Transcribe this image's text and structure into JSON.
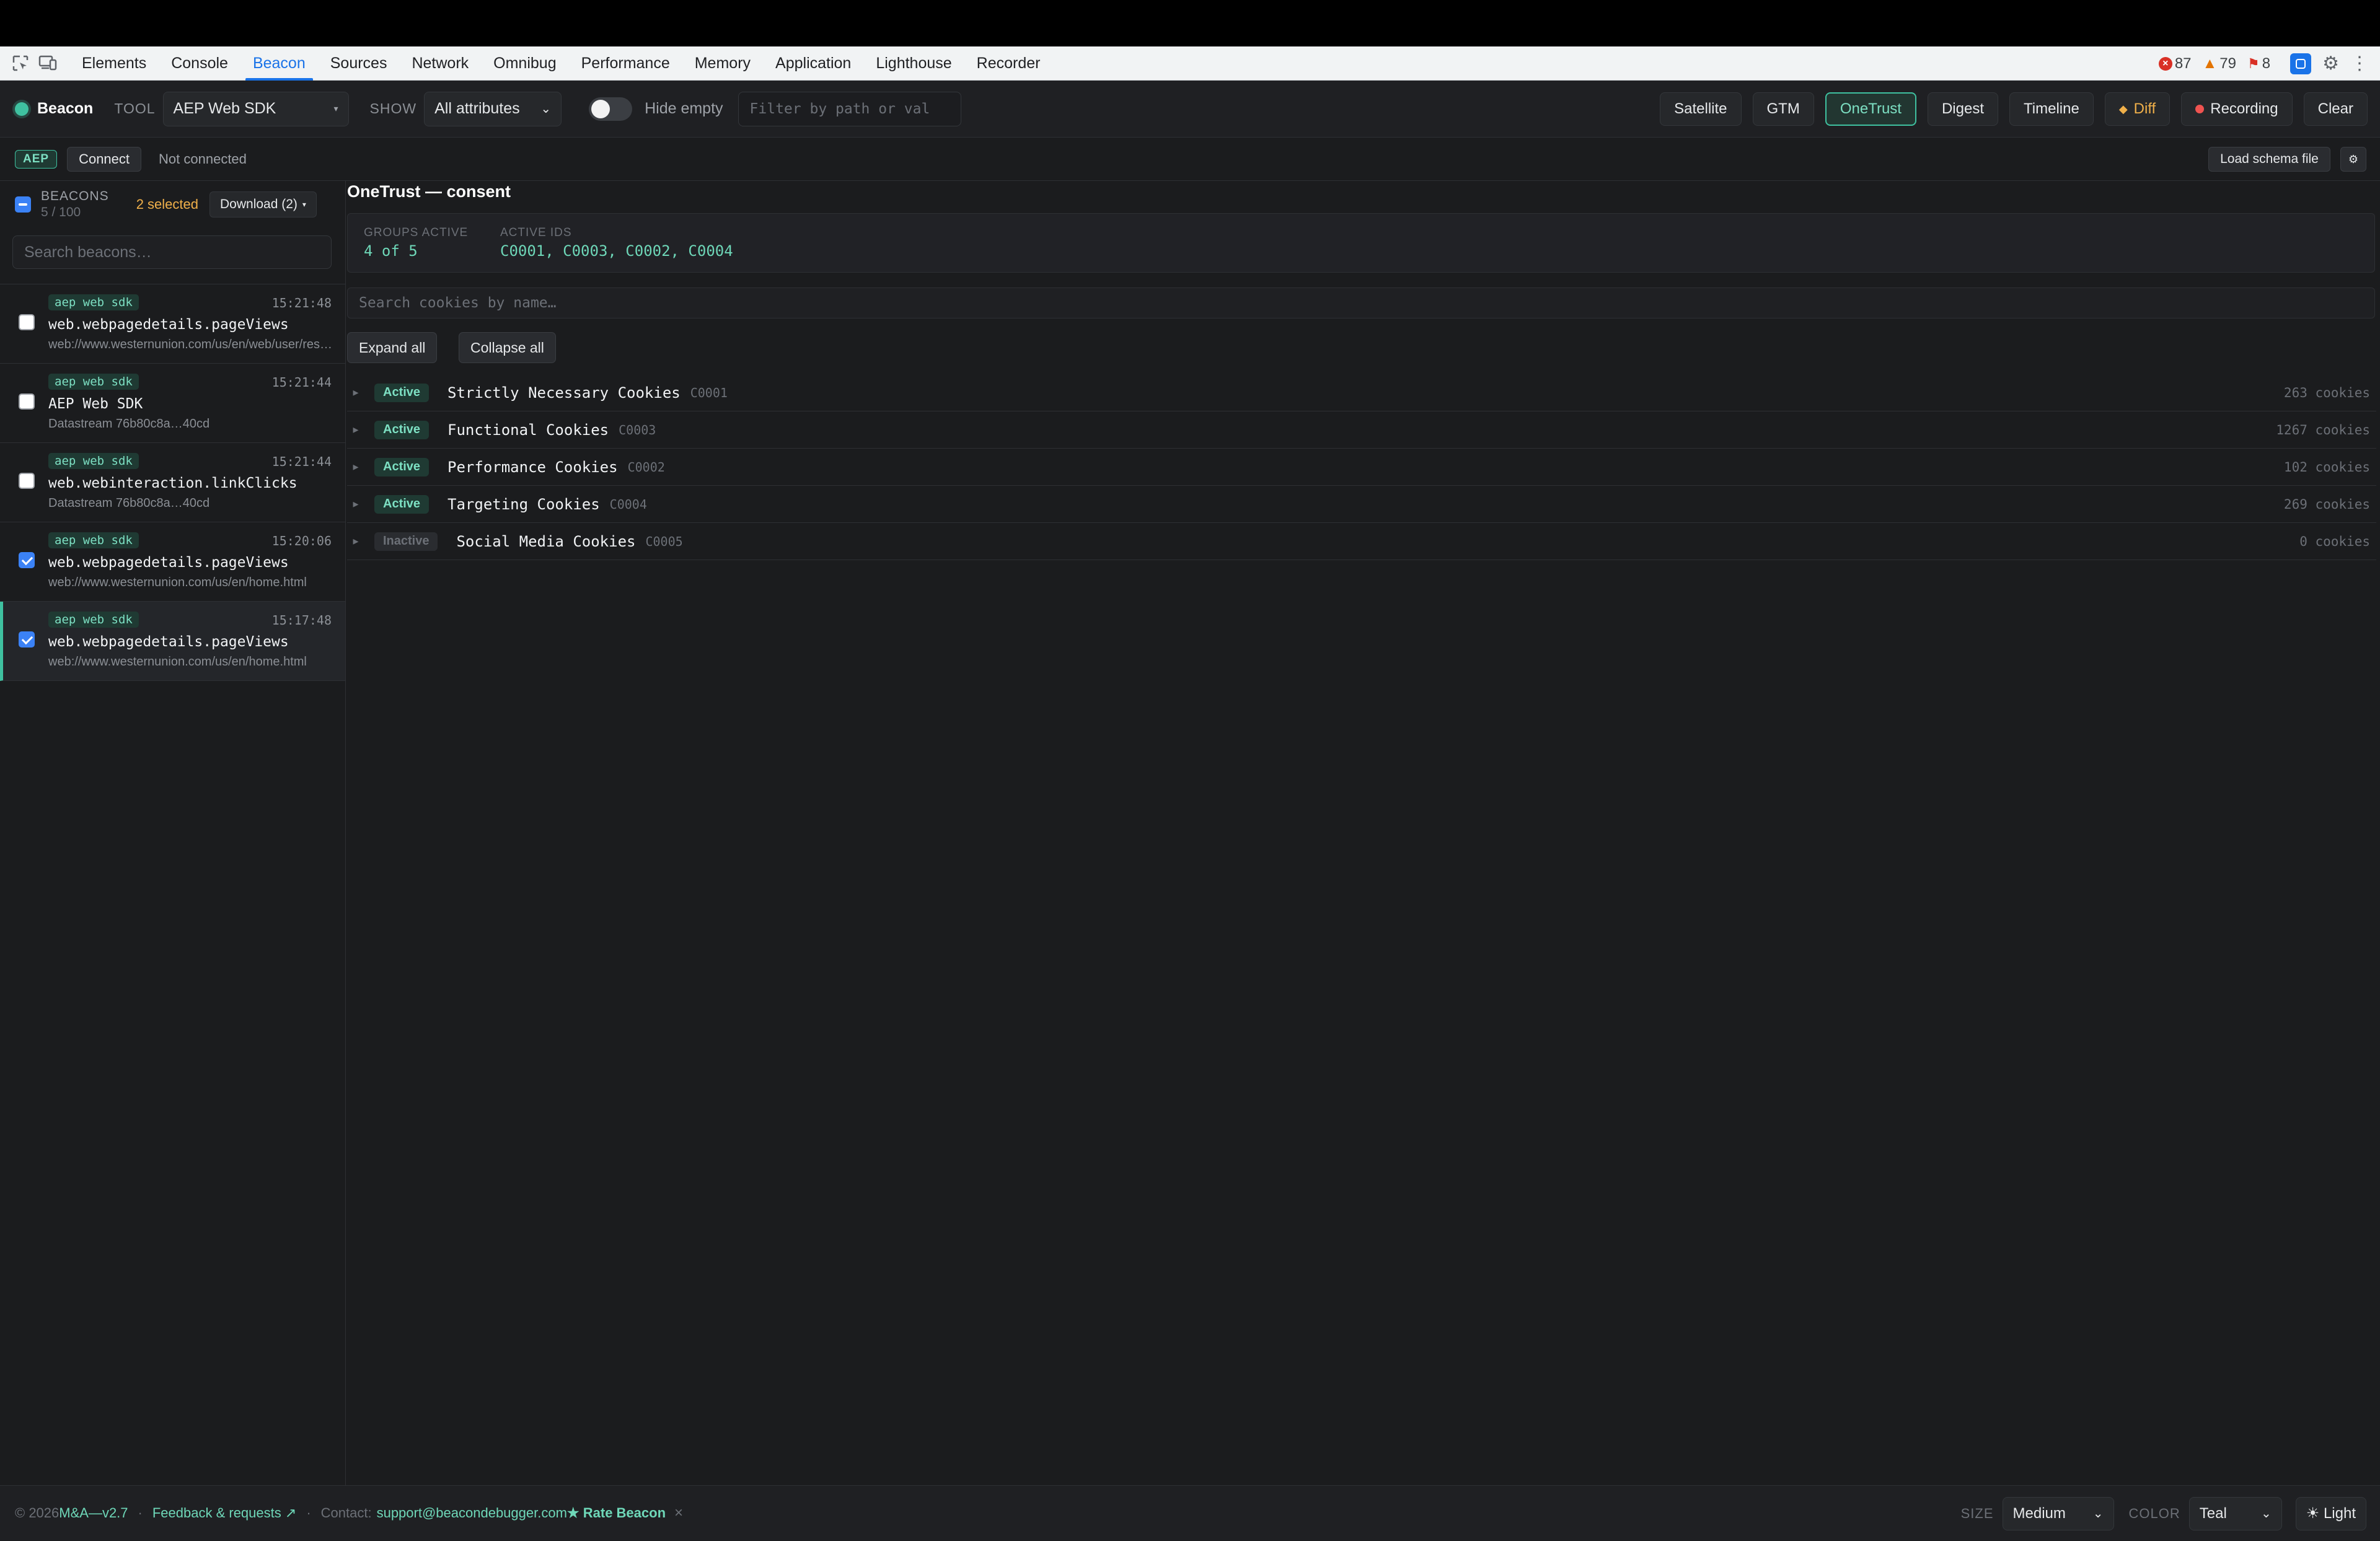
{
  "devtools": {
    "tabs": [
      "Elements",
      "Console",
      "Beacon",
      "Sources",
      "Network",
      "Omnibug",
      "Performance",
      "Memory",
      "Application",
      "Lighthouse",
      "Recorder"
    ],
    "active_tab": "Beacon",
    "errors": "87",
    "warnings": "79",
    "issues": "8"
  },
  "toolbar": {
    "brand": "Beacon",
    "tool_label": "TOOL",
    "tool_value": "AEP Web SDK",
    "show_label": "SHOW",
    "show_value": "All attributes",
    "hide_empty": "Hide empty",
    "filter_placeholder": "Filter by path or val",
    "buttons": {
      "satellite": "Satellite",
      "gtm": "GTM",
      "onetrust": "OneTrust",
      "digest": "Digest",
      "timeline": "Timeline",
      "diff": "Diff",
      "recording": "Recording",
      "clear": "Clear"
    }
  },
  "connection": {
    "badge": "AEP",
    "connect": "Connect",
    "status": "Not connected",
    "load_schema": "Load schema file",
    "settings": "⚙"
  },
  "sidebar": {
    "title": "BEACONS",
    "count": "5 / 100",
    "selected": "2 selected",
    "download": "Download (2)",
    "search_placeholder": "Search beacons…",
    "items": [
      {
        "tag": "aep web sdk",
        "time": "15:21:48",
        "name": "web.webpagedetails.pageViews",
        "sub": "web://www.westernunion.com/us/en/web/user/reset-password.html",
        "checked": false
      },
      {
        "tag": "aep web sdk",
        "time": "15:21:44",
        "name": "AEP Web SDK",
        "sub": "Datastream 76b80c8a…40cd",
        "checked": false
      },
      {
        "tag": "aep web sdk",
        "time": "15:21:44",
        "name": "web.webinteraction.linkClicks",
        "sub": "Datastream 76b80c8a…40cd",
        "checked": false
      },
      {
        "tag": "aep web sdk",
        "time": "15:20:06",
        "name": "web.webpagedetails.pageViews",
        "sub": "web://www.westernunion.com/us/en/home.html",
        "checked": true
      },
      {
        "tag": "aep web sdk",
        "time": "15:17:48",
        "name": "web.webpagedetails.pageViews",
        "sub": "web://www.westernunion.com/us/en/home.html",
        "checked": true
      }
    ]
  },
  "main": {
    "title": "OneTrust — consent",
    "groups_active_label": "GROUPS ACTIVE",
    "groups_active_value": "4 of 5",
    "active_ids_label": "ACTIVE IDS",
    "active_ids_value": "C0001, C0003, C0002, C0004",
    "search_placeholder": "Search cookies by name…",
    "expand_all": "Expand all",
    "collapse_all": "Collapse all",
    "groups": [
      {
        "status": "Active",
        "name": "Strictly Necessary Cookies",
        "id": "C0001",
        "count": "263 cookies"
      },
      {
        "status": "Active",
        "name": "Functional Cookies",
        "id": "C0003",
        "count": "1267 cookies"
      },
      {
        "status": "Active",
        "name": "Performance Cookies",
        "id": "C0002",
        "count": "102 cookies"
      },
      {
        "status": "Active",
        "name": "Targeting Cookies",
        "id": "C0004",
        "count": "269 cookies"
      },
      {
        "status": "Inactive",
        "name": "Social Media Cookies",
        "id": "C0005",
        "count": "0 cookies"
      }
    ]
  },
  "footer": {
    "copyright": "© 2026",
    "version": "M&A—v2.7",
    "feedback": "Feedback & requests ↗",
    "contact_label": "Contact:",
    "email": "support@beacondebugger.com",
    "rate": "★ Rate Beacon",
    "close": "×",
    "size_label": "SIZE",
    "size_value": "Medium",
    "color_label": "COLOR",
    "color_value": "Teal",
    "theme": "☀ Light"
  },
  "colors": {
    "accent": "#3fc1a0",
    "warning": "#f0b04a",
    "checkbox": "#3b82f6"
  }
}
